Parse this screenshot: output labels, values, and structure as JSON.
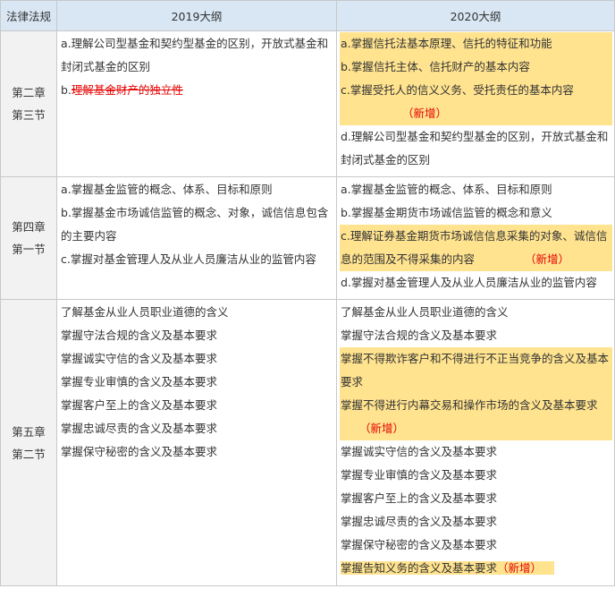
{
  "header": {
    "col1": "法律法规",
    "col2": "2019大纲",
    "col3": "2020大纲"
  },
  "rows": [
    {
      "section": [
        "第二章",
        "第三节"
      ],
      "y2019": [
        {
          "text": "a.理解公司型基金和契约型基金的区别，开放式基金和封闭式基金的区别"
        },
        {
          "prefix": "b.",
          "deleted": "理解基金财产的独立性"
        }
      ],
      "y2020": [
        {
          "text": "a.掌握信托法基本原理、信托的特征和功能",
          "hl": true
        },
        {
          "text": "b.掌握信托主体、信托财产的基本内容",
          "hl": true
        },
        {
          "text": "c.掌握受托人的信义义务、受托责任的基本内容",
          "hl": true
        },
        {
          "tag": "（新增）",
          "hl": true
        },
        {
          "text": "d.理解公司型基金和契约型基金的区别，开放式基金和封闭式基金的区别"
        }
      ]
    },
    {
      "section": [
        "第四章",
        "第一节"
      ],
      "y2019": [
        {
          "text": "a.掌握基金监管的概念、体系、目标和原则"
        },
        {
          "text": "b.掌握基金市场诚信监管的概念、对象，诚信信息包含的主要内容"
        },
        {
          "text": "c.掌握对基金管理人及从业人员廉洁从业的监管内容"
        }
      ],
      "y2020": [
        {
          "text": "a.掌握基金监管的概念、体系、目标和原则"
        },
        {
          "text": "b.掌握基金期货市场诚信监管的概念和意义"
        },
        {
          "text": "c.理解证券基金期货市场诚信信息采集的对象、诚信信息的范围及不得采集的内容",
          "tag": "（新增）",
          "hl": true
        },
        {
          "text": "d.掌握对基金管理人及从业人员廉洁从业的监管内容"
        }
      ]
    },
    {
      "section": [
        "第五章",
        "第二节"
      ],
      "y2019": [
        {
          "text": "了解基金从业人员职业道德的含义"
        },
        {
          "text": "掌握守法合规的含义及基本要求"
        },
        {
          "text": "掌握诚实守信的含义及基本要求"
        },
        {
          "text": "掌握专业审慎的含义及基本要求"
        },
        {
          "text": "掌握客户至上的含义及基本要求"
        },
        {
          "text": "掌握忠诚尽责的含义及基本要求"
        },
        {
          "text": "掌握保守秘密的含义及基本要求"
        }
      ],
      "y2020": [
        {
          "text": "了解基金从业人员职业道德的含义"
        },
        {
          "text": "掌握守法合规的含义及基本要求"
        },
        {
          "text": "掌握不得欺诈客户和不得进行不正当竞争的含义及基本要求",
          "hl": true
        },
        {
          "text": "掌握不得进行内幕交易和操作市场的含义及基本要求",
          "hl": true
        },
        {
          "tag": "（新增）",
          "hl": true
        },
        {
          "text": "掌握诚实守信的含义及基本要求"
        },
        {
          "text": "掌握专业审慎的含义及基本要求"
        },
        {
          "text": "掌握客户至上的含义及基本要求"
        },
        {
          "text": "掌握忠诚尽责的含义及基本要求"
        },
        {
          "text": "掌握保守秘密的含义及基本要求"
        },
        {
          "text": "掌握告知义务的含义及基本要求",
          "tag": "（新增）",
          "hl": true,
          "short": true
        }
      ]
    }
  ]
}
